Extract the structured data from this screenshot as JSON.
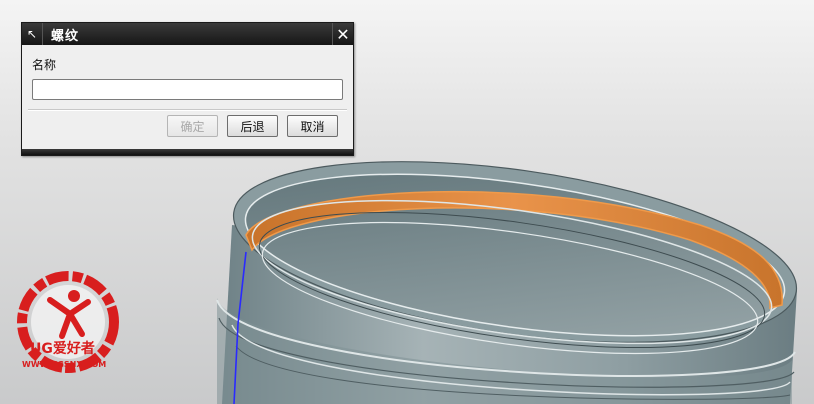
{
  "dialog": {
    "title": "螺纹",
    "name_label": "名称",
    "name_value": "",
    "buttons": {
      "ok": "确定",
      "back": "后退",
      "cancel": "取消"
    }
  },
  "watermark": {
    "brand": "UG爱好者",
    "url": "WWW.UGSNX.COM"
  },
  "colors": {
    "accent_orange": "#e08a3c",
    "model_gray": "#8d9ea3",
    "edge_blue": "#2a2aff",
    "logo_red": "#d81e1e"
  }
}
